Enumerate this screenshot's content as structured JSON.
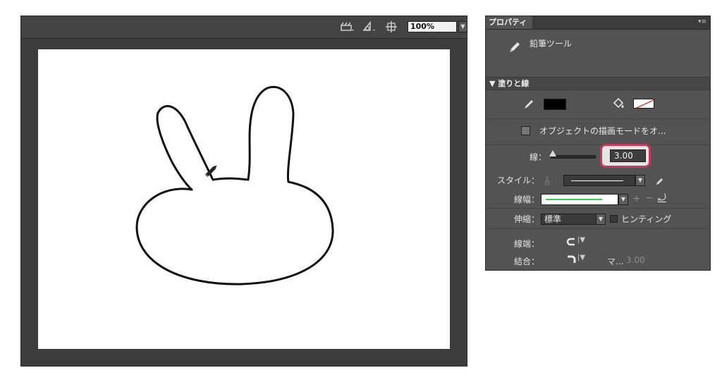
{
  "stage": {
    "zoom": "100%",
    "toolbar_icons": [
      "edit-scene-icon",
      "edit-symbol-icon",
      "center-stage-icon"
    ]
  },
  "panel": {
    "tab_title": "プロパティ",
    "tool_name": "鉛筆ツール",
    "section_fill_stroke": "▼ 塗りと線",
    "stroke_color": "#000000",
    "object_drawing_label": "オブジェクトの描画モードをオ...",
    "stroke_label": "線：",
    "stroke_value": "3.00",
    "style_label": "スタイル：",
    "width_label": "線幅：",
    "scale_label": "伸縮：",
    "scale_value": "標準",
    "hinting_label": "ヒンティング",
    "cap_label": "線端：",
    "join_label": "結合：",
    "miter_label": "マ...",
    "miter_value": "3.00",
    "highlight_color": "#c8385d"
  }
}
